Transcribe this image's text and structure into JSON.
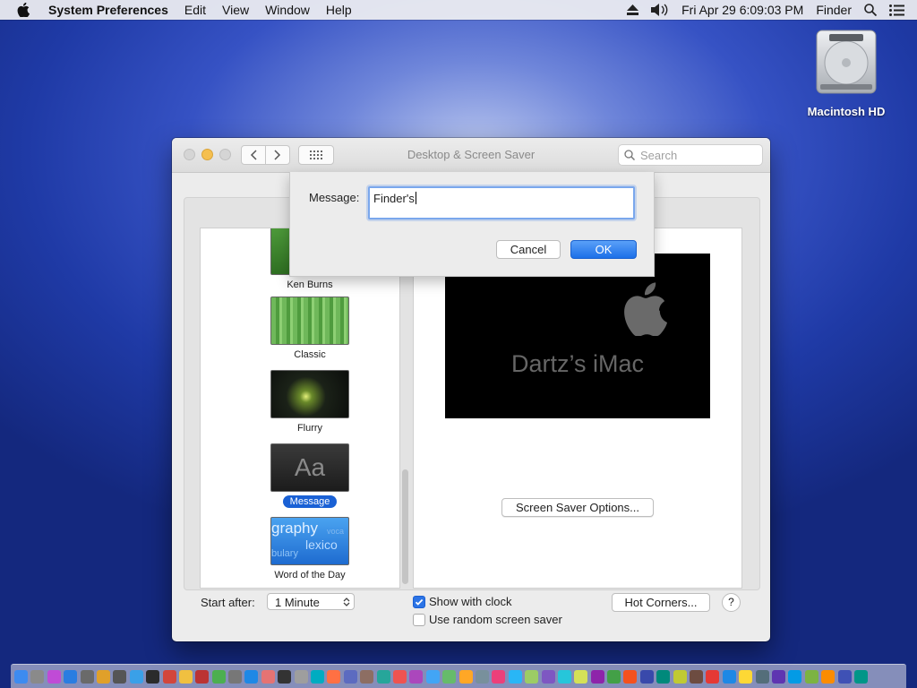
{
  "menubar": {
    "app": "System Preferences",
    "menus": [
      "Edit",
      "View",
      "Window",
      "Help"
    ],
    "datetime": "Fri Apr 29  6:09:03 PM",
    "right_app": "Finder"
  },
  "desktop": {
    "hd_label": "Macintosh HD"
  },
  "window": {
    "title": "Desktop & Screen Saver",
    "search_placeholder": "Search"
  },
  "savers": [
    {
      "name": "Ken Burns"
    },
    {
      "name": "Classic"
    },
    {
      "name": "Flurry"
    },
    {
      "name": "Message",
      "thumb_text": "Aa",
      "selected": true
    },
    {
      "name": "Word of the Day",
      "thumb_words": [
        "graphy",
        "lexico",
        "bulary",
        "voca"
      ]
    }
  ],
  "preview": {
    "text": "Dartz’s iMac"
  },
  "buttons": {
    "options": "Screen Saver Options...",
    "hot_corners": "Hot Corners...",
    "help": "?"
  },
  "start_after": {
    "label": "Start after:",
    "value": "1 Minute"
  },
  "checkboxes": {
    "show_clock": {
      "label": "Show with clock",
      "checked": true
    },
    "random": {
      "label": "Use random screen saver",
      "checked": false
    }
  },
  "sheet": {
    "label": "Message:",
    "value": "Finder's",
    "cancel": "Cancel",
    "ok": "OK"
  },
  "colors": {
    "accent": "#1a61d5",
    "traffic_min": "#f5bf4f"
  }
}
